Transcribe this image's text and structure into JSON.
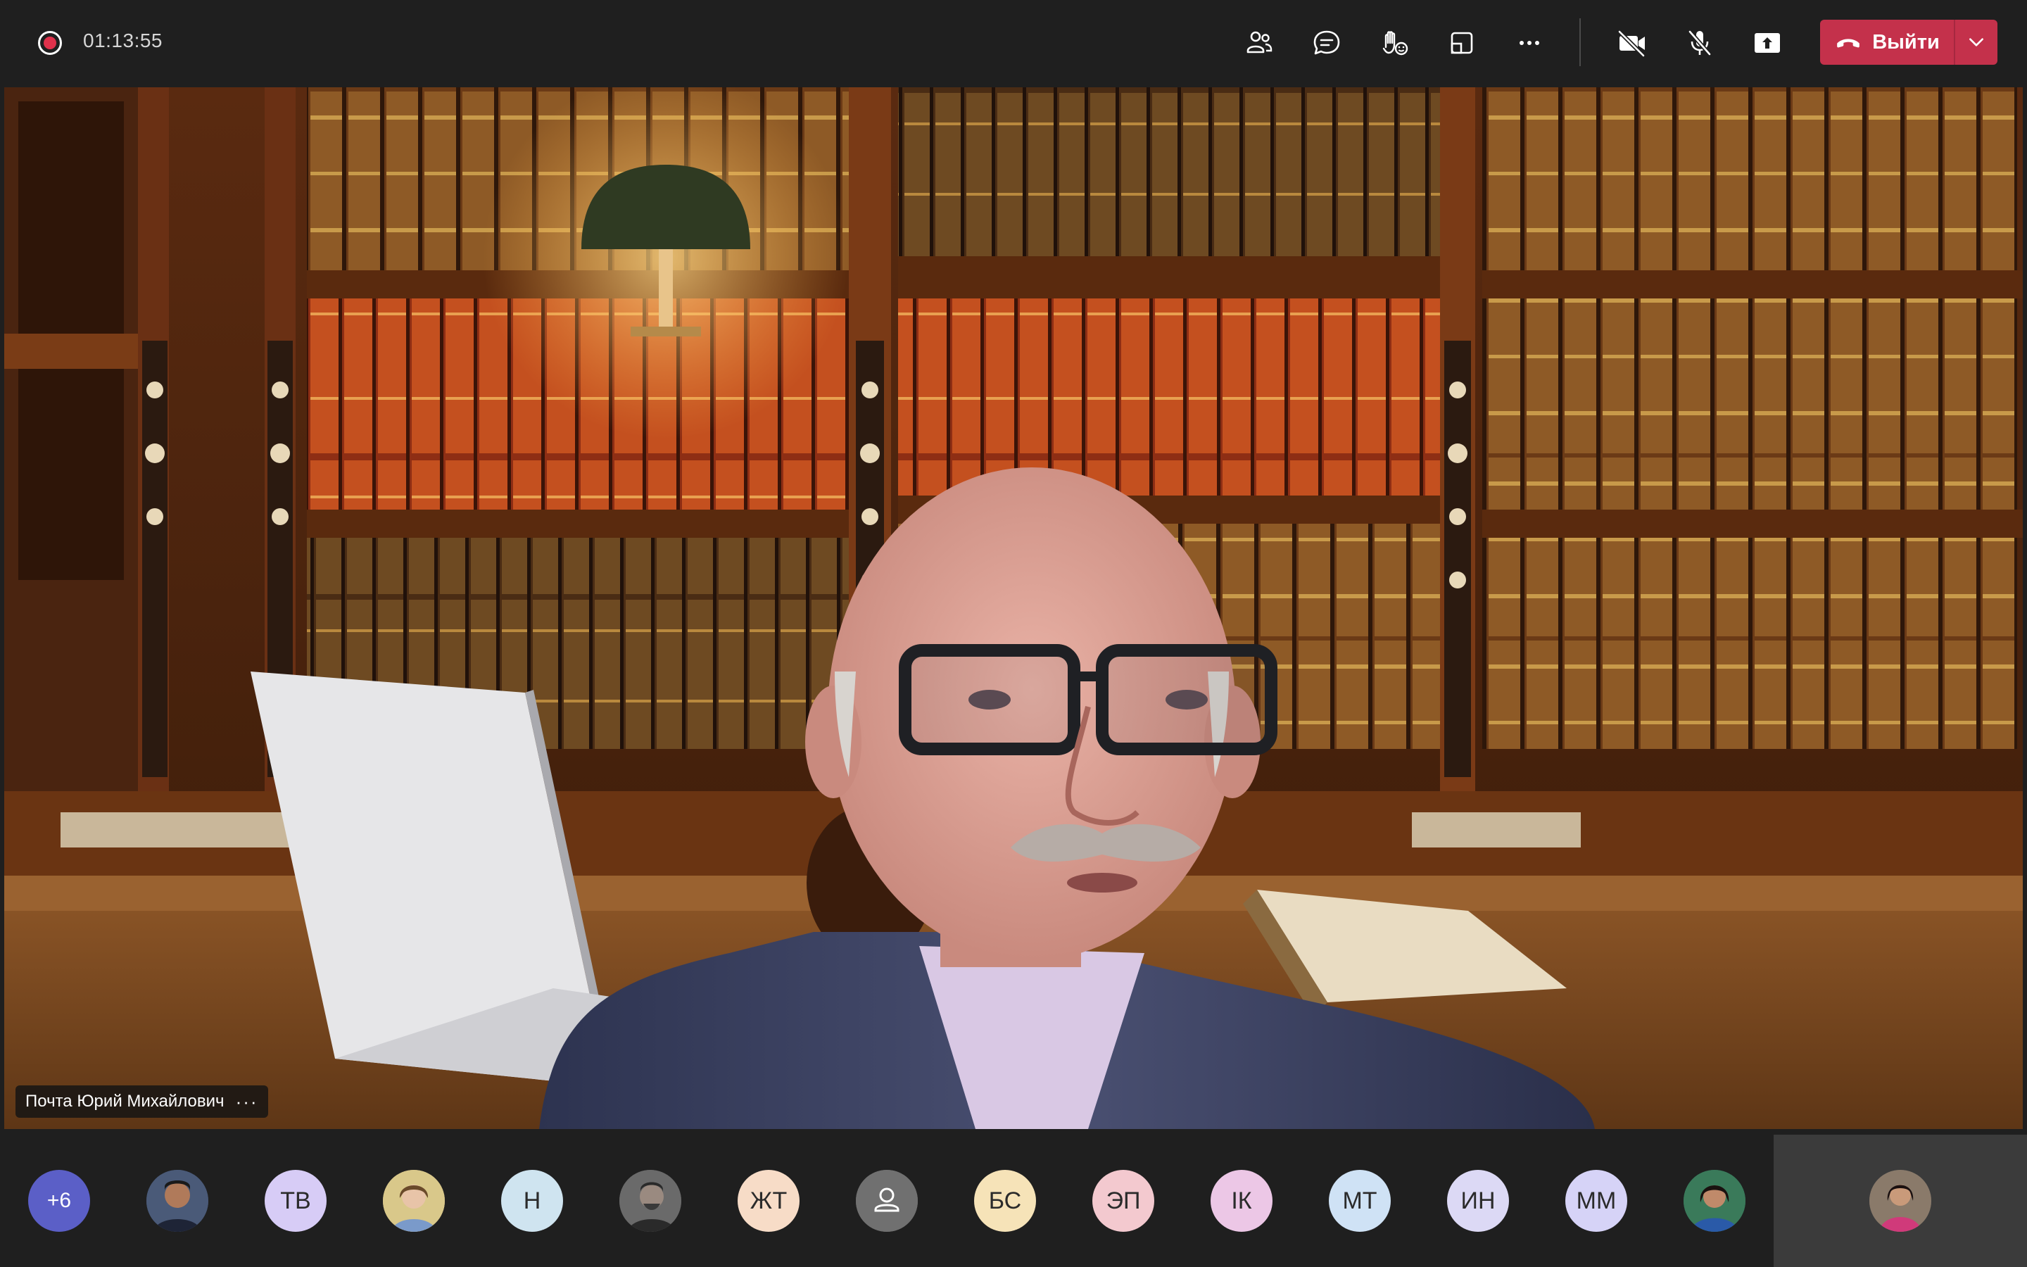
{
  "topbar": {
    "timer": "01:13:55",
    "icons": [
      "participants-icon",
      "chat-icon",
      "reactions-icon",
      "view-icon",
      "more-icon",
      "camera-off-icon",
      "mic-off-icon",
      "share-icon"
    ],
    "leave_label": "Выйти",
    "accent": "#c4314b"
  },
  "stage": {
    "participant_name": "Почта Юрий Михайлович",
    "more_label": "···"
  },
  "strip": {
    "more_count": "+6",
    "avatars": [
      {
        "type": "photo",
        "label": ""
      },
      {
        "type": "initials",
        "label": "ТВ",
        "color": "#d7ccf6"
      },
      {
        "type": "photo",
        "label": ""
      },
      {
        "type": "initials",
        "label": "Н",
        "color": "#cfe4f0"
      },
      {
        "type": "photo",
        "label": ""
      },
      {
        "type": "initials",
        "label": "ЖТ",
        "color": "#f7dcc7"
      },
      {
        "type": "placeholder",
        "label": ""
      },
      {
        "type": "initials",
        "label": "БС",
        "color": "#f6e3b8"
      },
      {
        "type": "initials",
        "label": "ЭП",
        "color": "#f3c9cf"
      },
      {
        "type": "initials",
        "label": "ІК",
        "color": "#ecc7e6"
      },
      {
        "type": "initials",
        "label": "МТ",
        "color": "#cfe2f5"
      },
      {
        "type": "initials",
        "label": "ИН",
        "color": "#dcd9f5"
      },
      {
        "type": "initials",
        "label": "ММ",
        "color": "#d6d3f7"
      },
      {
        "type": "photo",
        "label": ""
      }
    ],
    "self_view": {
      "type": "photo",
      "label": ""
    }
  }
}
